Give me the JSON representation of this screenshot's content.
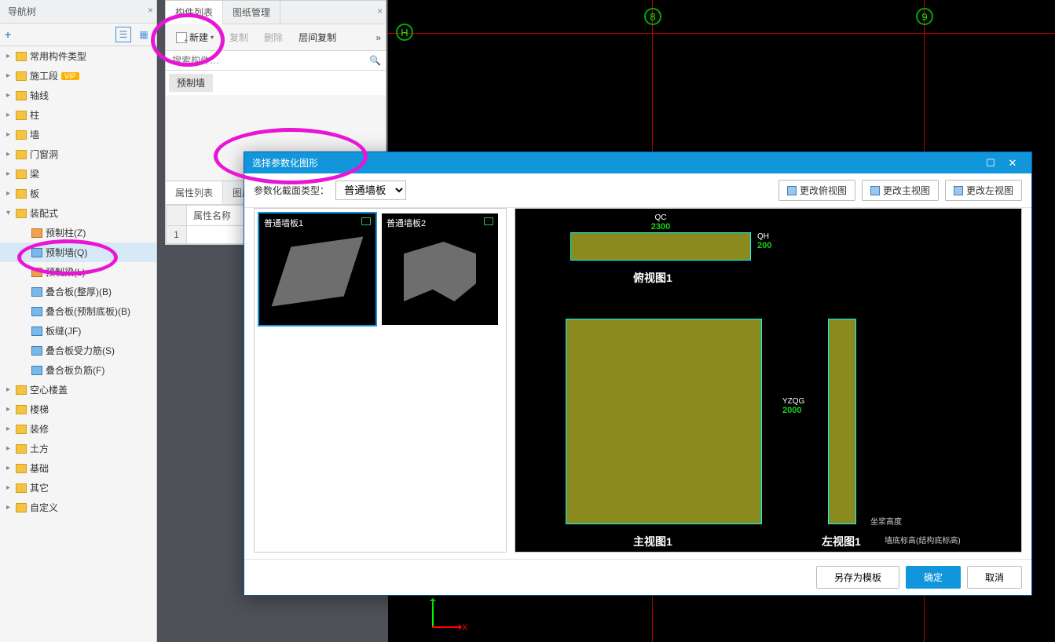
{
  "nav": {
    "title": "导航树",
    "items_top": [
      {
        "label": "常用构件类型"
      },
      {
        "label": "施工段",
        "vip": "VIP"
      },
      {
        "label": "轴线"
      },
      {
        "label": "柱"
      },
      {
        "label": "墙"
      },
      {
        "label": "门窗洞"
      },
      {
        "label": "梁"
      },
      {
        "label": "板"
      }
    ],
    "assembly": {
      "label": "装配式"
    },
    "assembly_children": [
      {
        "label": "预制柱(Z)"
      },
      {
        "label": "预制墙(Q)",
        "selected": true
      },
      {
        "label": "预制梁(L)"
      },
      {
        "label": "叠合板(整厚)(B)"
      },
      {
        "label": "叠合板(预制底板)(B)"
      },
      {
        "label": "板缝(JF)"
      },
      {
        "label": "叠合板受力筋(S)"
      },
      {
        "label": "叠合板负筋(F)"
      }
    ],
    "items_bottom": [
      {
        "label": "空心楼盖"
      },
      {
        "label": "楼梯"
      },
      {
        "label": "装修"
      },
      {
        "label": "土方"
      },
      {
        "label": "基础"
      },
      {
        "label": "其它"
      },
      {
        "label": "自定义"
      }
    ]
  },
  "list": {
    "tabs": {
      "components": "构件列表",
      "drawings": "图纸管理"
    },
    "toolbar": {
      "new": "新建",
      "copy": "复制",
      "delete": "删除",
      "floorcopy": "层间复制"
    },
    "search_placeholder": "搜索构件…",
    "item": "预制墙"
  },
  "props": {
    "tabs": {
      "attrs": "属性列表",
      "layers": "图层"
    },
    "header_name": "属性名称",
    "row1": "1"
  },
  "cad": {
    "axis_h": "H",
    "axis_8": "8",
    "axis_9": "9",
    "ucs_x": "X",
    "ucs_y": "Y"
  },
  "dialog": {
    "title": "选择参数化图形",
    "section_label": "参数化截面类型：",
    "section_value": "普通墙板",
    "btn_top": "更改俯视图",
    "btn_front": "更改主视图",
    "btn_left": "更改左视图",
    "templates": [
      {
        "label": "普通墙板1",
        "selected": true
      },
      {
        "label": "普通墙板2"
      }
    ],
    "dims": {
      "qc_label": "QC",
      "qc_val": "2300",
      "qh_label": "QH",
      "qh_val": "200",
      "yzqg_label": "YZQG",
      "yzqg_val": "2000"
    },
    "viewnames": {
      "top": "俯视图1",
      "front": "主视图1",
      "left": "左视图1"
    },
    "notes": {
      "n1": "坐浆高度",
      "n2": "墙底标高(结构底标高)"
    },
    "footer": {
      "save_tmpl": "另存为模板",
      "ok": "确定",
      "cancel": "取消"
    }
  }
}
